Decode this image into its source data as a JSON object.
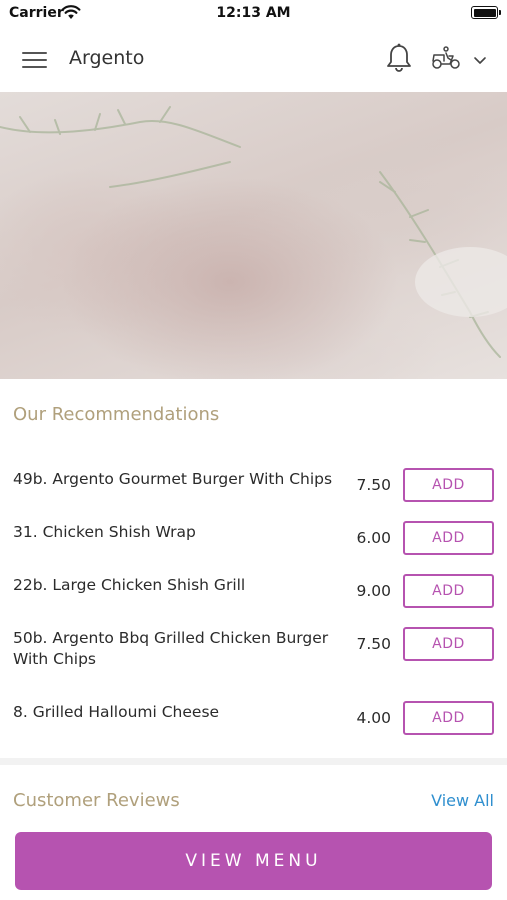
{
  "status_bar": {
    "carrier": "Carrier",
    "time": "12:13 AM"
  },
  "header": {
    "title": "Argento",
    "icons": [
      "menu-icon",
      "bell-icon",
      "delivery-scooter-icon",
      "chevron-down-icon"
    ]
  },
  "recommendations": {
    "title": "Our Recommendations",
    "add_label": "ADD",
    "items": [
      {
        "name": "49b. Argento Gourmet Burger With Chips",
        "price": "7.50"
      },
      {
        "name": "31. Chicken Shish Wrap",
        "price": "6.00"
      },
      {
        "name": "22b. Large Chicken Shish Grill",
        "price": "9.00"
      },
      {
        "name": "50b. Argento Bbq Grilled Chicken Burger With Chips",
        "price": "7.50"
      },
      {
        "name": "8. Grilled Halloumi Cheese",
        "price": "4.00"
      }
    ]
  },
  "reviews": {
    "title": "Customer Reviews",
    "view_all": "View All"
  },
  "footer": {
    "view_menu": "VIEW MENU"
  },
  "colors": {
    "accent": "#b653b0",
    "section_title": "#b0a07c",
    "link": "#2f8fcf"
  }
}
